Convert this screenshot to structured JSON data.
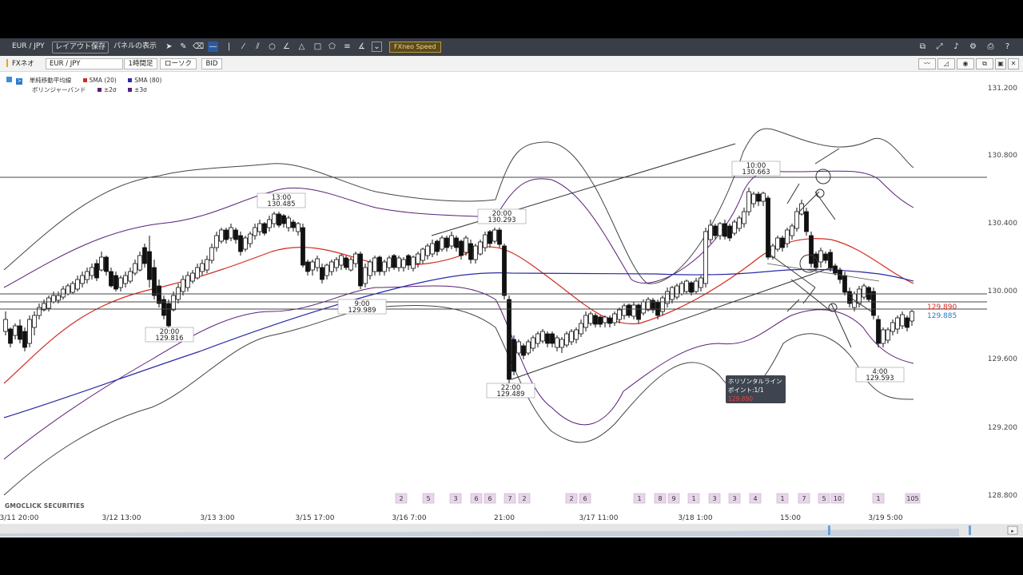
{
  "toolbar": {
    "symbol": "EUR / JPY",
    "save_layout": "レイアウト保存",
    "panel_display": "パネルの表示",
    "speed_label": "FXneo Speed"
  },
  "settings_bar": {
    "product": "FXネオ",
    "pair": "EUR / JPY",
    "timeframe": "1時間足",
    "chart_type": "ローソク",
    "price_type": "BID"
  },
  "legend": {
    "indicator1": "単純移動平均線",
    "sma20": "SMA (20)",
    "sma80": "SMA (80)",
    "indicator2": "ボリンジャーバンド",
    "bb2": "±2σ",
    "bb3": "±3σ",
    "sma20_color": "#d42b1f",
    "sma80_color": "#2a2aa8",
    "bb2_color": "#5a1f7a",
    "bb3_color": "#5a1f7a"
  },
  "watermark": "GMOCLICK SECURITIES",
  "price_axis": [
    "131.200",
    "130.800",
    "130.400",
    "130.000",
    "129.600",
    "129.200",
    "128.800"
  ],
  "current_price": {
    "ask": "129.890",
    "bid": "129.885"
  },
  "time_axis": [
    "3/11 20:00",
    "3/12 13:00",
    "3/13 3:00",
    "3/15 17:00",
    "3/16 7:00",
    "21:00",
    "3/17 11:00",
    "3/18 1:00",
    "15:00",
    "3/19 5:00"
  ],
  "annotations": [
    {
      "time": "13:00",
      "price": "130.485"
    },
    {
      "time": "20:00",
      "price": "130.293"
    },
    {
      "time": "10:00",
      "price": "130.663"
    },
    {
      "time": "9:00",
      "price": "129.989"
    },
    {
      "time": "20:00",
      "price": "129.816"
    },
    {
      "time": "22:00",
      "price": "129.489"
    },
    {
      "time": "4:00",
      "price": "129.593"
    }
  ],
  "tooltip": {
    "title": "ホリゾンタルライン",
    "points": "ポイント:1/1",
    "value": "129.890"
  },
  "event_markers": [
    "2",
    "5",
    "3",
    "6",
    "6",
    "7",
    "2",
    "2",
    "6",
    "1",
    "8",
    "9",
    "1",
    "3",
    "3",
    "4",
    "1",
    "7",
    "5",
    "10",
    "1",
    "105"
  ]
}
